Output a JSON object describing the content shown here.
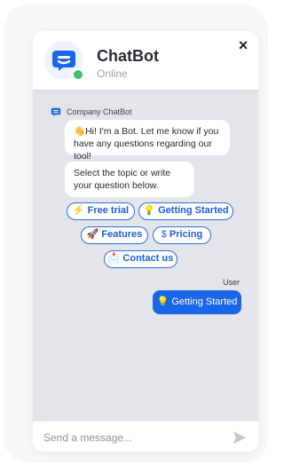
{
  "header": {
    "title": "ChatBot",
    "status": "Online",
    "close_label": "×",
    "accent": "#1a66e8",
    "online_color": "#3bc16b"
  },
  "conversation": {
    "bot_name": "Company ChatBot",
    "messages": [
      {
        "emoji": "👋",
        "text": "Hi! I'm a Bot. Let me know if you have any questions regarding our tool!"
      },
      {
        "emoji": "",
        "text": "Select the topic or write your question below."
      }
    ],
    "quick_replies": [
      {
        "emoji": "⚡",
        "label": "Free trial"
      },
      {
        "emoji": "💡",
        "label": "Getting Started"
      },
      {
        "emoji": "🚀",
        "label": "Features"
      },
      {
        "emoji": "$",
        "label": "Pricing"
      },
      {
        "emoji": "📩",
        "label": "Contact us"
      }
    ],
    "user_label": "User",
    "user_message": {
      "emoji": "💡",
      "text": "Getting Started"
    }
  },
  "composer": {
    "placeholder": "Send a message...",
    "send_icon": "send-icon"
  }
}
